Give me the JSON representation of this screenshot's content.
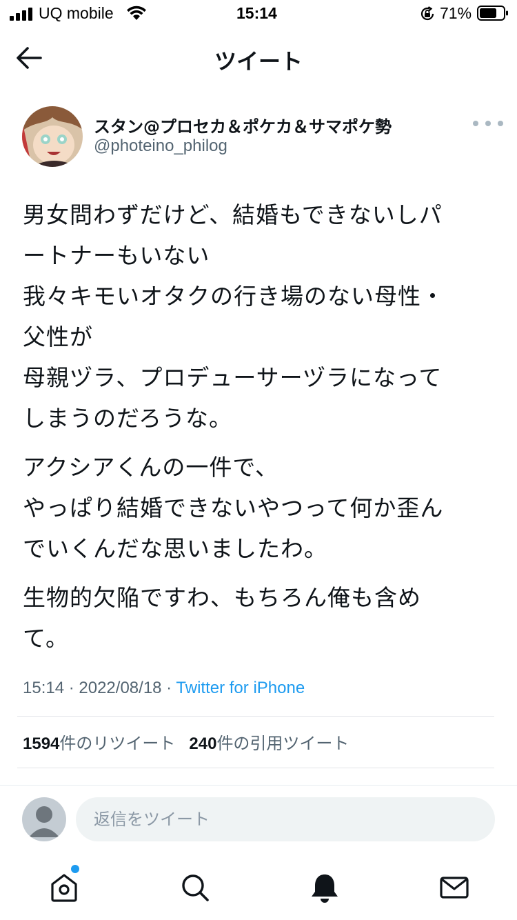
{
  "status_bar": {
    "carrier": "UQ mobile",
    "time": "15:14",
    "battery": "71%",
    "icons": [
      "signal-icon",
      "wifi-icon",
      "orientation-lock-icon",
      "battery-icon"
    ]
  },
  "nav": {
    "title": "ツイート",
    "back_icon": "arrow-left-icon"
  },
  "author": {
    "display_name": "スタン@プロセカ＆ポケカ＆サマポケ勢",
    "handle": "@photeino_philog"
  },
  "tweet": {
    "paragraphs": [
      [
        "男女問わずだけど、結婚もできないしパ",
        "ートナーもいない",
        "我々キモいオタクの行き場のない母性・",
        "父性が",
        "母親ヅラ、プロデューサーヅラになって",
        "しまうのだろうな。"
      ],
      [
        "アクシアくんの一件で、",
        "やっぱり結婚できないやつって何か歪ん",
        "でいくんだな思いましたわ。"
      ],
      [
        "生物的欠陥ですわ、もちろん俺も含め",
        "て。"
      ]
    ],
    "time": "15:14",
    "date": "2022/08/18",
    "separator": " · ",
    "source": "Twitter for iPhone"
  },
  "stats": {
    "retweets_count": "1594",
    "retweets_label": "件のリツイート",
    "quotes_count": "240",
    "quotes_label": "件の引用ツイート"
  },
  "reply": {
    "placeholder": "返信をツイート"
  },
  "tabbar": {
    "items": [
      "home-icon",
      "search-icon",
      "notifications-bell-icon",
      "messages-envelope-icon"
    ],
    "accent": "#1d9bf0"
  },
  "colors": {
    "text": "#0f1419",
    "secondary": "#536471",
    "link": "#1d9bf0",
    "background": "#ffffff"
  }
}
